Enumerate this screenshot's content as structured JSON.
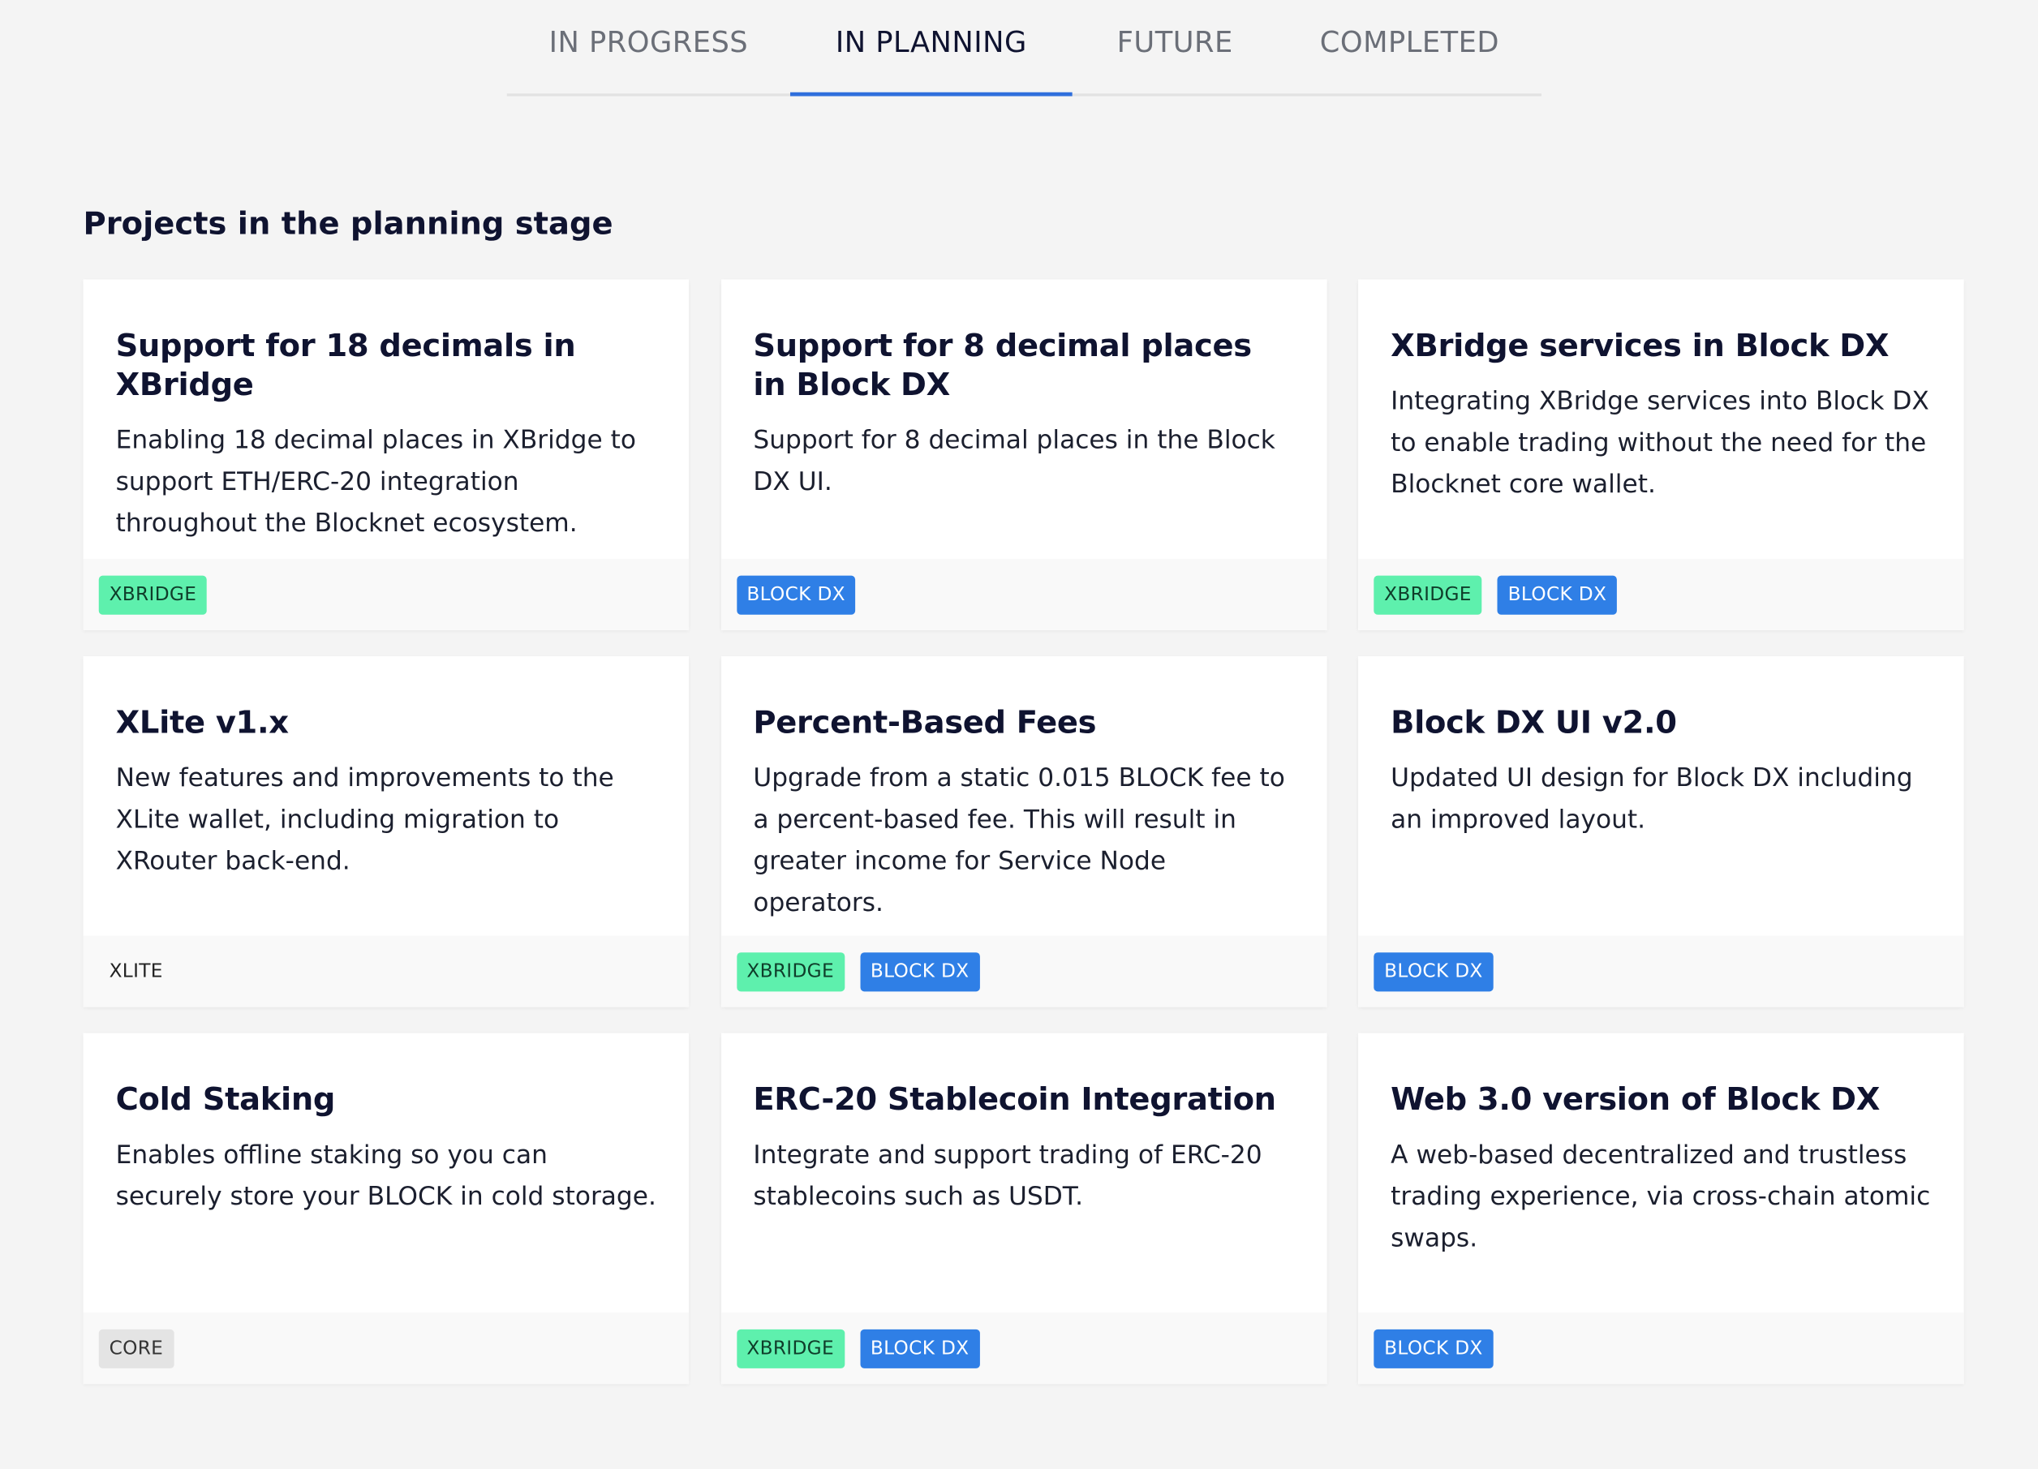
{
  "tabs": [
    {
      "label": "IN PROGRESS",
      "active": false
    },
    {
      "label": "IN PLANNING",
      "active": true
    },
    {
      "label": "FUTURE",
      "active": false
    },
    {
      "label": "COMPLETED",
      "active": false
    }
  ],
  "section_title": "Projects in the planning stage",
  "tag_colors": {
    "xbridge": "#5ef0ad",
    "blockdx": "#2f7fe6",
    "core": "#e4e4e4",
    "active_tab_underline": "#2f6fdc"
  },
  "cards": [
    {
      "title": "Support for 18 decimals in XBridge",
      "description": "Enabling 18 decimal places in XBridge to support ETH/ERC-20 integration throughout the Blocknet ecosystem.",
      "tags": [
        {
          "label": "XBRIDGE",
          "kind": "xbridge"
        }
      ]
    },
    {
      "title": "Support for 8 decimal places in Block DX",
      "description": "Support for 8 decimal places in the Block DX UI.",
      "tags": [
        {
          "label": "BLOCK DX",
          "kind": "blockdx"
        }
      ]
    },
    {
      "title": "XBridge services in Block DX",
      "description": "Integrating XBridge services into Block DX to enable trading without the need for the Blocknet core wallet.",
      "tags": [
        {
          "label": "XBRIDGE",
          "kind": "xbridge"
        },
        {
          "label": "BLOCK DX",
          "kind": "blockdx"
        }
      ]
    },
    {
      "title": "XLite v1.x",
      "description": "New features and improvements to the XLite wallet, including migration to XRouter back-end.",
      "tags": [
        {
          "label": "XLITE",
          "kind": "xlite"
        }
      ]
    },
    {
      "title": "Percent-Based Fees",
      "description": "Upgrade from a static 0.015 BLOCK fee to a percent-based fee. This will result in greater income for Service Node operators.",
      "tags": [
        {
          "label": "XBRIDGE",
          "kind": "xbridge"
        },
        {
          "label": "BLOCK DX",
          "kind": "blockdx"
        }
      ]
    },
    {
      "title": "Block DX UI v2.0",
      "description": "Updated UI design for Block DX including an improved layout.",
      "tags": [
        {
          "label": "BLOCK DX",
          "kind": "blockdx"
        }
      ]
    },
    {
      "title": "Cold Staking",
      "description": "Enables offline staking so you can securely store your BLOCK in cold storage.",
      "tags": [
        {
          "label": "CORE",
          "kind": "core"
        }
      ]
    },
    {
      "title": "ERC-20 Stablecoin Integration",
      "description": "Integrate and support trading of ERC-20 stablecoins such as USDT.",
      "tags": [
        {
          "label": "XBRIDGE",
          "kind": "xbridge"
        },
        {
          "label": "BLOCK DX",
          "kind": "blockdx"
        }
      ]
    },
    {
      "title": "Web 3.0 version of Block DX",
      "description": "A web-based decentralized and trustless trading experience, via cross-chain atomic swaps.",
      "tags": [
        {
          "label": "BLOCK DX",
          "kind": "blockdx"
        }
      ]
    }
  ]
}
